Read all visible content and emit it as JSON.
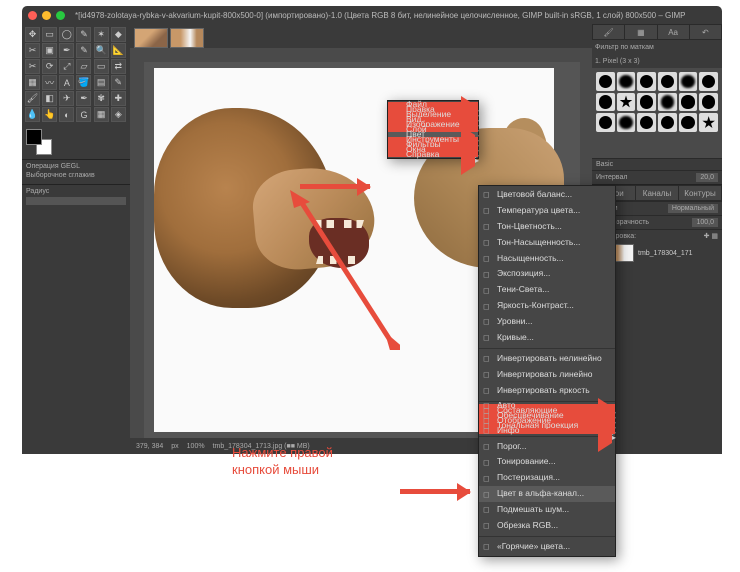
{
  "window": {
    "title": "*[id4978-zolotaya-rybka-v-akvarium-kupit-800x500-0] (импортировано)-1.0 (Цвета RGB 8 бит, нелинейное целочисленное, GIMP built-in sRGB, 1 слой) 800x500 – GIMP"
  },
  "toolbox": {
    "section_ops": "Операция GEGL",
    "section_sel": "Выборочное сглажив",
    "radius_label": "Радиус"
  },
  "status": {
    "coords": "379, 384",
    "unit": "px",
    "zoom": "100%",
    "file": "tmb_178304_1713.jpg (■■ MB)"
  },
  "right": {
    "search_label": "Фильтр по маткам",
    "patterns_label": "1. Pixel (3 x 3)",
    "basic": "Basic",
    "interval_label": "Интервал",
    "interval_val": "20,0",
    "tabs": {
      "layers": "Слои",
      "channels": "Каналы",
      "paths": "Контуры"
    },
    "mode_label": "Режим",
    "mode_val": "Нормальный",
    "opacity_label": "Непрозрачность",
    "opacity_val": "100,0",
    "lock_label": "Блокировка:",
    "layer_name": "tmb_178304_171"
  },
  "menu1": {
    "items": [
      {
        "k": "file",
        "label": "Файл",
        "arrow": true
      },
      {
        "k": "edit",
        "label": "Правка",
        "arrow": true
      },
      {
        "k": "select",
        "label": "Выделение",
        "arrow": true
      },
      {
        "k": "view",
        "label": "Вид",
        "arrow": true
      },
      {
        "k": "image",
        "label": "Изображение",
        "arrow": true
      },
      {
        "k": "layer",
        "label": "Слой",
        "arrow": true
      },
      {
        "k": "color",
        "label": "Цвет",
        "arrow": true,
        "hl": true
      },
      {
        "k": "tools",
        "label": "Инструменты",
        "arrow": true
      },
      {
        "k": "filters",
        "label": "Фильтры",
        "arrow": true
      },
      {
        "k": "windows",
        "label": "Окна",
        "arrow": true
      },
      {
        "k": "help",
        "label": "Справка",
        "arrow": true
      }
    ]
  },
  "menu2": {
    "groups": [
      [
        {
          "label": "Цветовой баланс..."
        },
        {
          "label": "Температура цвета..."
        },
        {
          "label": "Тон-Цветность..."
        },
        {
          "label": "Тон-Насыщенность..."
        },
        {
          "label": "Насыщенность..."
        },
        {
          "label": "Экспозиция..."
        },
        {
          "label": "Тени-Света..."
        },
        {
          "label": "Яркость-Контраст..."
        },
        {
          "label": "Уровни..."
        },
        {
          "label": "Кривые..."
        }
      ],
      [
        {
          "label": "Инвертировать нелинейно"
        },
        {
          "label": "Инвертировать линейно"
        },
        {
          "label": "Инвертировать яркость"
        }
      ],
      [
        {
          "label": "Авто",
          "arrow": true
        },
        {
          "label": "Составляющие",
          "arrow": true
        },
        {
          "label": "Обесцвечивание",
          "arrow": true
        },
        {
          "label": "Отображение",
          "arrow": true
        },
        {
          "label": "Тональная проекция",
          "arrow": true
        },
        {
          "label": "Инфо",
          "arrow": true
        }
      ],
      [
        {
          "label": "Порог..."
        },
        {
          "label": "Тонирование..."
        },
        {
          "label": "Постеризация..."
        },
        {
          "label": "Цвет в альфа-канал...",
          "hl": true
        },
        {
          "label": "Подмешать шум..."
        },
        {
          "label": "Обрезка RGB..."
        }
      ],
      [
        {
          "label": "«Горячие» цвета..."
        }
      ]
    ]
  },
  "annotation": {
    "text_l1": "Нажмите правой",
    "text_l2": "кнопкой мыши"
  }
}
